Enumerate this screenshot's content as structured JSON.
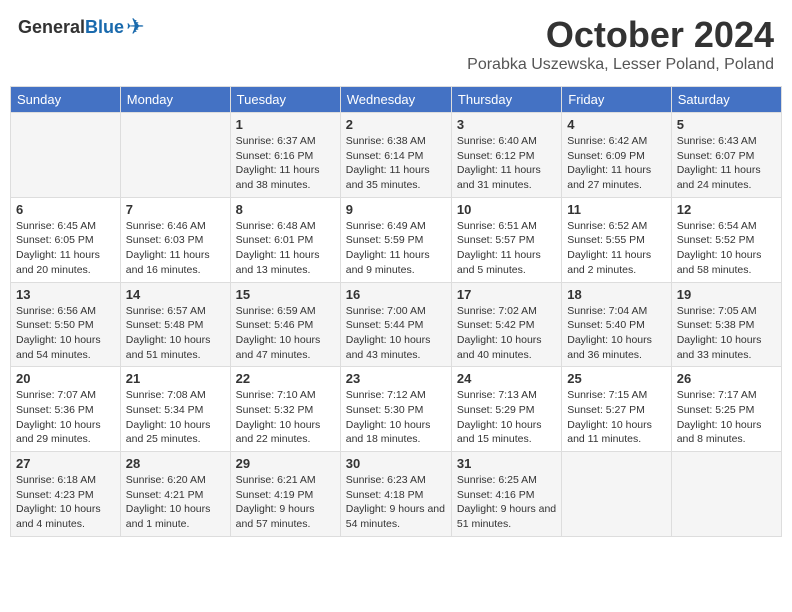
{
  "header": {
    "logo_general": "General",
    "logo_blue": "Blue",
    "month_title": "October 2024",
    "location": "Porabka Uszewska, Lesser Poland, Poland"
  },
  "days_of_week": [
    "Sunday",
    "Monday",
    "Tuesday",
    "Wednesday",
    "Thursday",
    "Friday",
    "Saturday"
  ],
  "weeks": [
    [
      {
        "day": "",
        "info": ""
      },
      {
        "day": "",
        "info": ""
      },
      {
        "day": "1",
        "info": "Sunrise: 6:37 AM\nSunset: 6:16 PM\nDaylight: 11 hours and 38 minutes."
      },
      {
        "day": "2",
        "info": "Sunrise: 6:38 AM\nSunset: 6:14 PM\nDaylight: 11 hours and 35 minutes."
      },
      {
        "day": "3",
        "info": "Sunrise: 6:40 AM\nSunset: 6:12 PM\nDaylight: 11 hours and 31 minutes."
      },
      {
        "day": "4",
        "info": "Sunrise: 6:42 AM\nSunset: 6:09 PM\nDaylight: 11 hours and 27 minutes."
      },
      {
        "day": "5",
        "info": "Sunrise: 6:43 AM\nSunset: 6:07 PM\nDaylight: 11 hours and 24 minutes."
      }
    ],
    [
      {
        "day": "6",
        "info": "Sunrise: 6:45 AM\nSunset: 6:05 PM\nDaylight: 11 hours and 20 minutes."
      },
      {
        "day": "7",
        "info": "Sunrise: 6:46 AM\nSunset: 6:03 PM\nDaylight: 11 hours and 16 minutes."
      },
      {
        "day": "8",
        "info": "Sunrise: 6:48 AM\nSunset: 6:01 PM\nDaylight: 11 hours and 13 minutes."
      },
      {
        "day": "9",
        "info": "Sunrise: 6:49 AM\nSunset: 5:59 PM\nDaylight: 11 hours and 9 minutes."
      },
      {
        "day": "10",
        "info": "Sunrise: 6:51 AM\nSunset: 5:57 PM\nDaylight: 11 hours and 5 minutes."
      },
      {
        "day": "11",
        "info": "Sunrise: 6:52 AM\nSunset: 5:55 PM\nDaylight: 11 hours and 2 minutes."
      },
      {
        "day": "12",
        "info": "Sunrise: 6:54 AM\nSunset: 5:52 PM\nDaylight: 10 hours and 58 minutes."
      }
    ],
    [
      {
        "day": "13",
        "info": "Sunrise: 6:56 AM\nSunset: 5:50 PM\nDaylight: 10 hours and 54 minutes."
      },
      {
        "day": "14",
        "info": "Sunrise: 6:57 AM\nSunset: 5:48 PM\nDaylight: 10 hours and 51 minutes."
      },
      {
        "day": "15",
        "info": "Sunrise: 6:59 AM\nSunset: 5:46 PM\nDaylight: 10 hours and 47 minutes."
      },
      {
        "day": "16",
        "info": "Sunrise: 7:00 AM\nSunset: 5:44 PM\nDaylight: 10 hours and 43 minutes."
      },
      {
        "day": "17",
        "info": "Sunrise: 7:02 AM\nSunset: 5:42 PM\nDaylight: 10 hours and 40 minutes."
      },
      {
        "day": "18",
        "info": "Sunrise: 7:04 AM\nSunset: 5:40 PM\nDaylight: 10 hours and 36 minutes."
      },
      {
        "day": "19",
        "info": "Sunrise: 7:05 AM\nSunset: 5:38 PM\nDaylight: 10 hours and 33 minutes."
      }
    ],
    [
      {
        "day": "20",
        "info": "Sunrise: 7:07 AM\nSunset: 5:36 PM\nDaylight: 10 hours and 29 minutes."
      },
      {
        "day": "21",
        "info": "Sunrise: 7:08 AM\nSunset: 5:34 PM\nDaylight: 10 hours and 25 minutes."
      },
      {
        "day": "22",
        "info": "Sunrise: 7:10 AM\nSunset: 5:32 PM\nDaylight: 10 hours and 22 minutes."
      },
      {
        "day": "23",
        "info": "Sunrise: 7:12 AM\nSunset: 5:30 PM\nDaylight: 10 hours and 18 minutes."
      },
      {
        "day": "24",
        "info": "Sunrise: 7:13 AM\nSunset: 5:29 PM\nDaylight: 10 hours and 15 minutes."
      },
      {
        "day": "25",
        "info": "Sunrise: 7:15 AM\nSunset: 5:27 PM\nDaylight: 10 hours and 11 minutes."
      },
      {
        "day": "26",
        "info": "Sunrise: 7:17 AM\nSunset: 5:25 PM\nDaylight: 10 hours and 8 minutes."
      }
    ],
    [
      {
        "day": "27",
        "info": "Sunrise: 6:18 AM\nSunset: 4:23 PM\nDaylight: 10 hours and 4 minutes."
      },
      {
        "day": "28",
        "info": "Sunrise: 6:20 AM\nSunset: 4:21 PM\nDaylight: 10 hours and 1 minute."
      },
      {
        "day": "29",
        "info": "Sunrise: 6:21 AM\nSunset: 4:19 PM\nDaylight: 9 hours and 57 minutes."
      },
      {
        "day": "30",
        "info": "Sunrise: 6:23 AM\nSunset: 4:18 PM\nDaylight: 9 hours and 54 minutes."
      },
      {
        "day": "31",
        "info": "Sunrise: 6:25 AM\nSunset: 4:16 PM\nDaylight: 9 hours and 51 minutes."
      },
      {
        "day": "",
        "info": ""
      },
      {
        "day": "",
        "info": ""
      }
    ]
  ]
}
